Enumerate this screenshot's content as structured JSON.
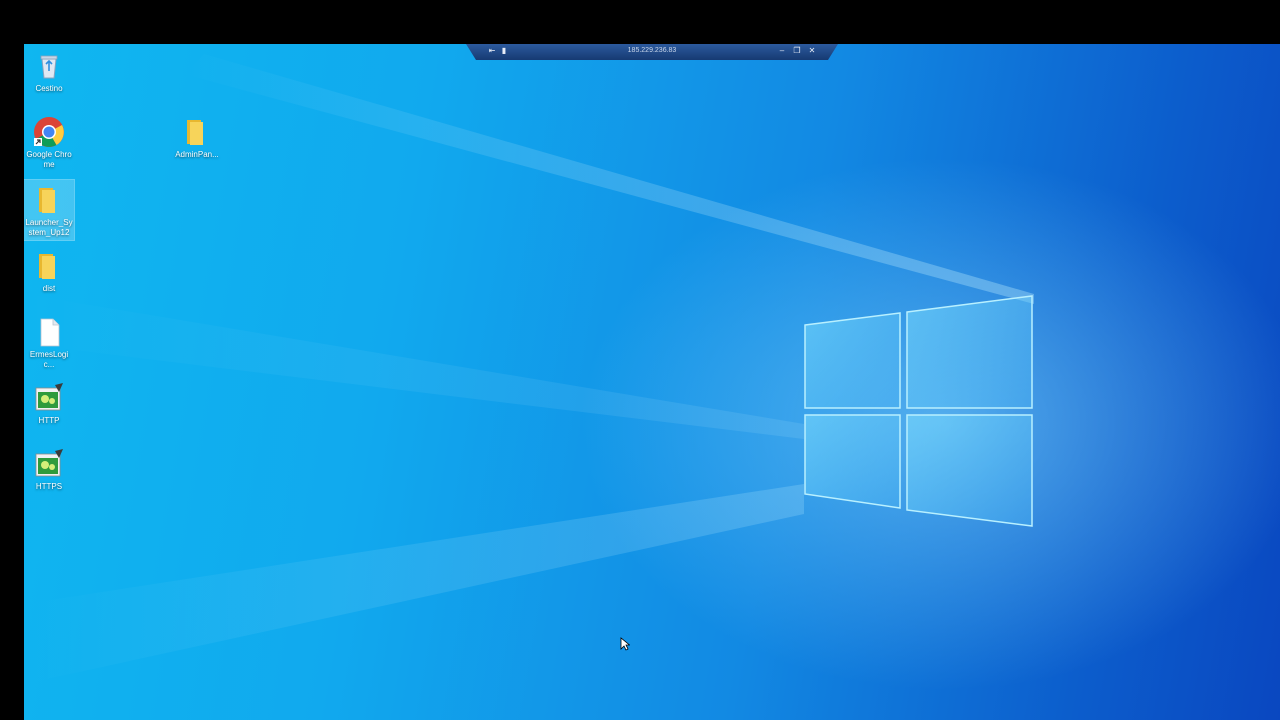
{
  "remote_bar": {
    "title": "185.229.236.83"
  },
  "desktop_icons": [
    {
      "label": "Cestino",
      "icon": "recycle-bin-icon"
    },
    {
      "label": "Google Chrome",
      "icon": "chrome-icon"
    },
    {
      "label": "Launcher_System_Up12",
      "icon": "folder-icon"
    },
    {
      "label": "dist",
      "icon": "folder-icon"
    },
    {
      "label": "ErmesLogic...",
      "icon": "document-icon"
    },
    {
      "label": "HTTP",
      "icon": "script-icon"
    },
    {
      "label": "HTTPS",
      "icon": "script-icon"
    },
    {
      "label": "AdminPan...",
      "icon": "folder-icon"
    }
  ],
  "colors": {
    "folder": "#f5c93e",
    "wallpaper_light": "#0fb7f0",
    "wallpaper_dark": "#0a47c0"
  }
}
